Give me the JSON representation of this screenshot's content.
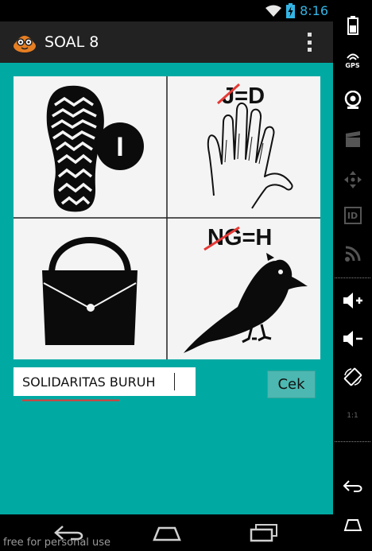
{
  "status_bar": {
    "time": "8:16"
  },
  "action_bar": {
    "title": "SOAL 8"
  },
  "puzzle": {
    "rule_top": {
      "struck": "J",
      "rest": "=D"
    },
    "rule_bottom": {
      "struck": "NG",
      "rest": "=H"
    },
    "circle_letter": "I"
  },
  "answer": {
    "value": "SOLIDARITAS BURUH"
  },
  "check_button": {
    "label": "Cek"
  },
  "watermark": "free for personal use",
  "side_panel": {
    "gps_label": "GPS",
    "id_label": "ID",
    "scale_label": "1:1"
  },
  "colors": {
    "accent": "#00aaa3",
    "clock": "#33b5e5",
    "strike": "#e53935"
  }
}
